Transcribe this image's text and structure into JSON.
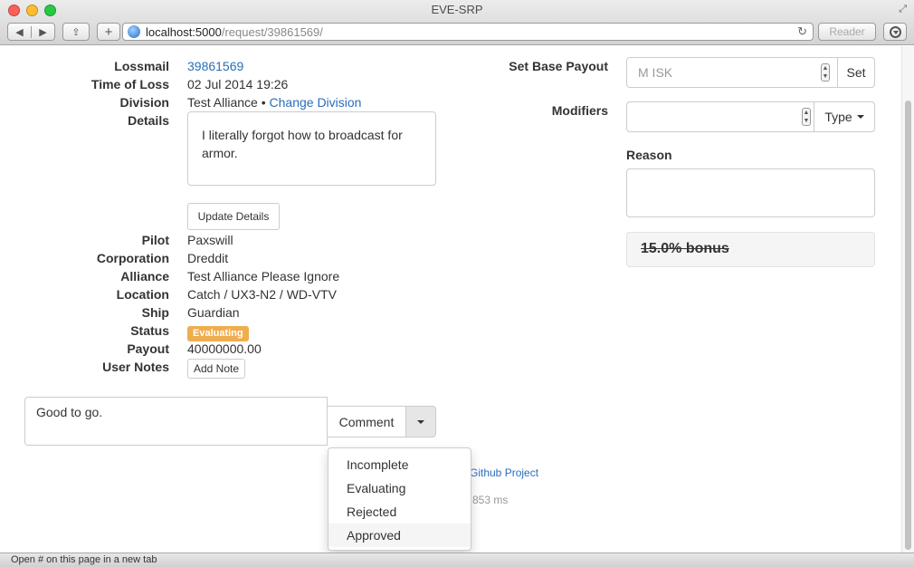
{
  "window": {
    "title": "EVE-SRP"
  },
  "toolbar": {
    "back_icon": "◀",
    "forward_icon": "▶",
    "share_icon": "⇪",
    "new_tab_icon": "+",
    "reload_icon": "↻",
    "reader_label": "Reader"
  },
  "address": {
    "host": "localhost:5000",
    "path": "/request/39861569/"
  },
  "request": {
    "labels": {
      "lossmail": "Lossmail",
      "time_of_loss": "Time of Loss",
      "division": "Division",
      "details": "Details",
      "pilot": "Pilot",
      "corporation": "Corporation",
      "alliance": "Alliance",
      "location": "Location",
      "ship": "Ship",
      "status": "Status",
      "payout": "Payout",
      "user_notes": "User Notes"
    },
    "lossmail_id": "39861569",
    "time_of_loss": "02 Jul 2014 19:26",
    "division": "Test Alliance",
    "division_sep": "•",
    "change_division": "Change Division",
    "details_text": "I literally forgot how to broadcast for armor.",
    "update_details": "Update Details",
    "pilot": "Paxswill",
    "corporation": "Dreddit",
    "alliance": "Test Alliance Please Ignore",
    "location": "Catch / UX3-N2 / WD-VTV",
    "ship": "Guardian",
    "status": "Evaluating",
    "payout": "40000000.00",
    "add_note": "Add Note"
  },
  "comment": {
    "text": "Good to go.",
    "button": "Comment",
    "dropdown_items": [
      "Incomplete",
      "Evaluating",
      "Rejected",
      "Approved"
    ]
  },
  "footer": {
    "github": "Github Project",
    "timing": "853 ms"
  },
  "payout_form": {
    "base_label": "Set Base Payout",
    "base_placeholder": "M ISK",
    "set_button": "Set",
    "modifiers_label": "Modifiers",
    "type_button": "Type",
    "reason_label": "Reason",
    "bonus": "15.0% bonus"
  },
  "statusbar": {
    "text": "Open # on this page in a new tab"
  },
  "colors": {
    "link": "#2a6ebb",
    "status_badge": "#f0ad4e"
  }
}
